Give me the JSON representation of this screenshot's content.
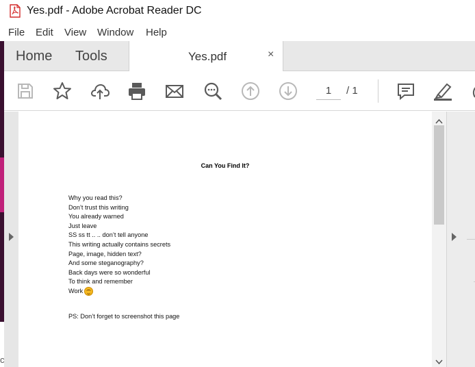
{
  "window": {
    "title": "Yes.pdf - Adobe Acrobat Reader DC"
  },
  "menu": {
    "items": [
      "File",
      "Edit",
      "View",
      "Window",
      "Help"
    ]
  },
  "tabs": {
    "home": "Home",
    "tools": "Tools",
    "document": "Yes.pdf",
    "close_symbol": "×"
  },
  "toolbar": {
    "icons": [
      "save-icon",
      "bookmark-star-icon",
      "cloud-upload-icon",
      "print-icon",
      "email-icon",
      "zoom-search-icon",
      "page-up-icon",
      "page-down-icon",
      "comment-icon",
      "highlight-pen-icon"
    ],
    "current_page": "1",
    "page_total": "/ 1"
  },
  "document": {
    "heading": "Can You Find It?",
    "lines": [
      "Why you read this?",
      "Don’t trust this writing",
      "You already warned",
      "Just leave",
      "SS ss tt .. .. don’t tell anyone",
      "This writing actually contains secrets",
      "Page, image, hidden text?",
      "And some steganography?",
      "Back days were so wonderful",
      "To think and remember",
      "Work"
    ],
    "ps": "PS: Don’t forget to screenshot this page"
  },
  "desktop": {
    "edge_char": "c"
  },
  "colors": {
    "icon_gray": "#5a5a5a",
    "disabled_gray": "#b8b8b8",
    "tab_bar_bg": "#e8e8e8",
    "pdf_red": "#d32a2a"
  }
}
